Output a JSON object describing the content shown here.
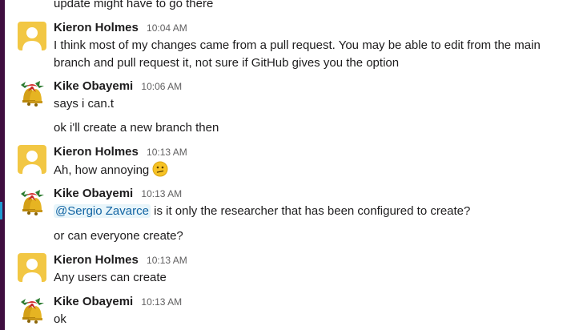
{
  "messages": [
    {
      "continuation": "update might have to go there"
    },
    {
      "author": "Kieron Holmes",
      "avatar": "kieron-avatar",
      "time": "10:04 AM",
      "lines": [
        "I think most of my changes came from a pull request. You may be able to edit from the main",
        "branch and pull request it, not sure if GitHub gives you the option"
      ]
    },
    {
      "author": "Kike Obayemi",
      "avatar": "bells-avatar",
      "time": "10:06 AM",
      "lines": [
        "says i can.t"
      ]
    },
    {
      "continuation": "ok i'll create a new branch then"
    },
    {
      "author": "Kieron Holmes",
      "avatar": "kieron-avatar",
      "time": "10:13 AM",
      "text": "Ah, how annoying",
      "emoji": "confused-face-icon"
    },
    {
      "author": "Kike Obayemi",
      "avatar": "bells-avatar",
      "time": "10:13 AM",
      "mention": "@Sergio Zavarce",
      "text": " is it only the researcher that has been configured to create?"
    },
    {
      "continuation": "or can everyone create?"
    },
    {
      "author": "Kieron Holmes",
      "avatar": "kieron-avatar",
      "time": "10:13 AM",
      "lines": [
        "Any users can create"
      ]
    },
    {
      "author": "Kike Obayemi",
      "avatar": "bells-avatar",
      "time": "10:13 AM",
      "lines": [
        "ok"
      ]
    }
  ],
  "colors": {
    "sidebar": "#3f0e40",
    "sidebar_mark": "#1d9bd1",
    "mention_bg": "#e8f5fa",
    "mention_text": "#1264a3",
    "timestamp": "#616061",
    "kieron_avatar": "#f2c744"
  }
}
